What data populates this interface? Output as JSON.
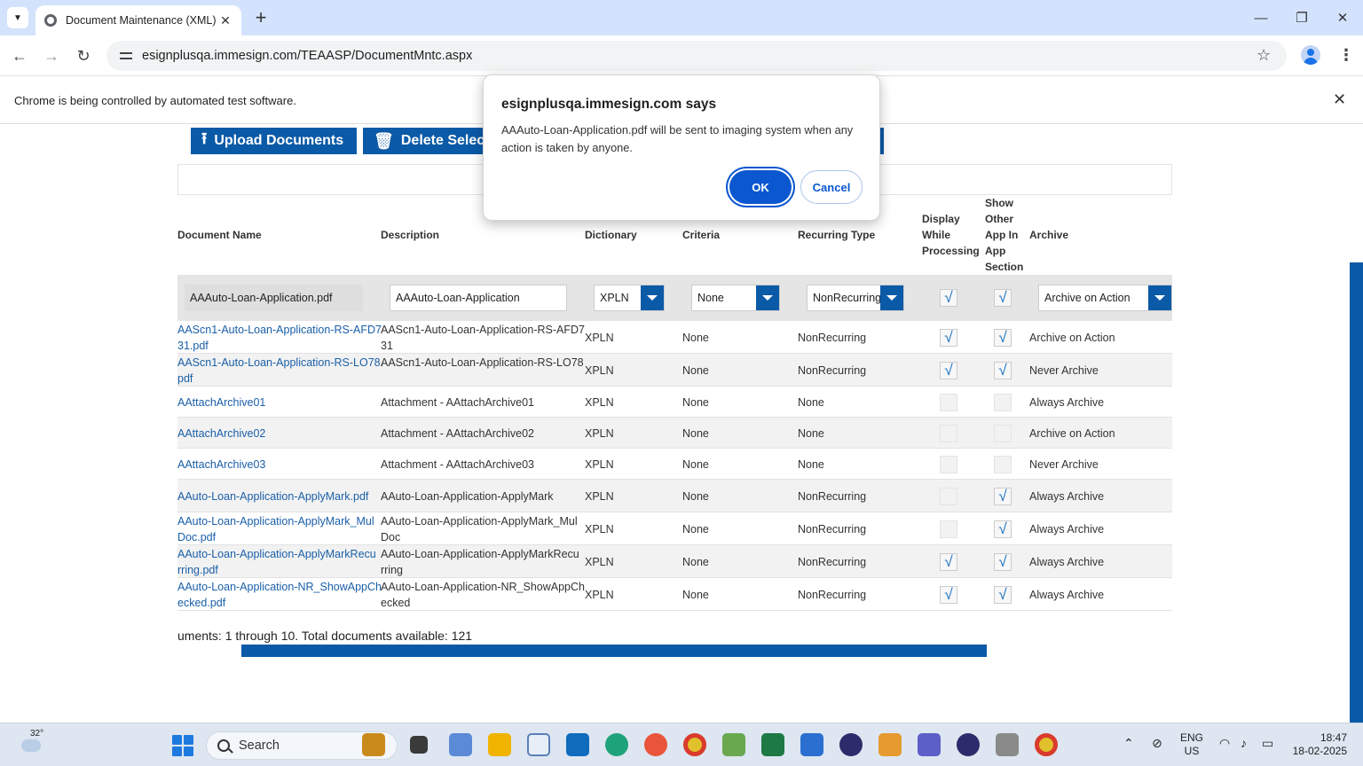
{
  "browser": {
    "tab_title": "Document Maintenance (XML)",
    "url": "esignplusqa.immesign.com/TEAASP/DocumentMntc.aspx",
    "infobar_message": "Chrome is being controlled by automated test software."
  },
  "toolbar": {
    "upload_label": "Upload Documents",
    "delete_label": "Delete Select"
  },
  "table": {
    "headers": {
      "doc_name": "Document Name",
      "description": "Description",
      "dictionary": "Dictionary",
      "criteria": "Criteria",
      "recurring": "Recurring Type",
      "display_1": "Display",
      "display_2": "While",
      "display_3": "Processing",
      "show_1": "Show",
      "show_2": "Other",
      "show_3": "App In",
      "show_4": "App",
      "show_5": "Section",
      "archive": "Archive"
    },
    "edit_row": {
      "doc_name": "AAAuto-Loan-Application.pdf",
      "description": "AAAuto-Loan-Application",
      "dictionary": "XPLN",
      "criteria": "None",
      "recurring": "NonRecurring",
      "display_checked": "√",
      "show_checked": "√",
      "archive": "Archive on Action"
    },
    "rows": [
      {
        "name_1": "AAScn1-Auto-Loan-Application-RS-AFD7",
        "name_2": "31.pdf",
        "desc_1": "AAScn1-Auto-Loan-Application-RS-AFD7",
        "desc_2": "31",
        "dict": "XPLN",
        "criteria": "None",
        "recurring": "NonRecurring",
        "display": "√",
        "show": "√",
        "archive": "Archive on Action"
      },
      {
        "name_1": "AAScn1-Auto-Loan-Application-RS-LO78.",
        "name_2": "pdf",
        "desc_1": "AAScn1-Auto-Loan-Application-RS-LO78",
        "desc_2": "",
        "dict": "XPLN",
        "criteria": "None",
        "recurring": "NonRecurring",
        "display": "√",
        "show": "√",
        "archive": "Never Archive"
      },
      {
        "name_1": "AAttachArchive01",
        "name_2": "",
        "desc_1": "Attachment - AAttachArchive01",
        "desc_2": "",
        "dict": "XPLN",
        "criteria": "None",
        "recurring": "None",
        "display": "",
        "show": "",
        "archive": "Always Archive"
      },
      {
        "name_1": "AAttachArchive02",
        "name_2": "",
        "desc_1": "Attachment - AAttachArchive02",
        "desc_2": "",
        "dict": "XPLN",
        "criteria": "None",
        "recurring": "None",
        "display": "",
        "show": "",
        "archive": "Archive on Action"
      },
      {
        "name_1": "AAttachArchive03",
        "name_2": "",
        "desc_1": "Attachment - AAttachArchive03",
        "desc_2": "",
        "dict": "XPLN",
        "criteria": "None",
        "recurring": "None",
        "display": "",
        "show": "",
        "archive": "Never Archive"
      },
      {
        "name_1": "AAuto-Loan-Application-ApplyMark.pdf",
        "name_2": "",
        "desc_1": "AAuto-Loan-Application-ApplyMark",
        "desc_2": "",
        "dict": "XPLN",
        "criteria": "None",
        "recurring": "NonRecurring",
        "display": "",
        "show": "√",
        "archive": "Always Archive"
      },
      {
        "name_1": "AAuto-Loan-Application-ApplyMark_Mul",
        "name_2": "Doc.pdf",
        "desc_1": "AAuto-Loan-Application-ApplyMark_Mul",
        "desc_2": "Doc",
        "dict": "XPLN",
        "criteria": "None",
        "recurring": "NonRecurring",
        "display": "",
        "show": "√",
        "archive": "Always Archive"
      },
      {
        "name_1": "AAuto-Loan-Application-ApplyMarkRecu",
        "name_2": "rring.pdf",
        "desc_1": "AAuto-Loan-Application-ApplyMarkRecu",
        "desc_2": "rring",
        "dict": "XPLN",
        "criteria": "None",
        "recurring": "NonRecurring",
        "display": "√",
        "show": "√",
        "archive": "Always Archive"
      },
      {
        "name_1": "AAuto-Loan-Application-NR_ShowAppCh",
        "name_2": "ecked.pdf",
        "desc_1": "AAuto-Loan-Application-NR_ShowAppCh",
        "desc_2": "ecked",
        "dict": "XPLN",
        "criteria": "None",
        "recurring": "NonRecurring",
        "display": "√",
        "show": "√",
        "archive": "Always Archive"
      }
    ],
    "footer": "uments: 1 through 10. Total documents available: 121"
  },
  "dialog": {
    "title": "esignplusqa.immesign.com says",
    "message": "AAAuto-Loan-Application.pdf will be sent to imaging system when any action is taken by anyone.",
    "ok_label": "OK",
    "cancel_label": "Cancel"
  },
  "taskbar": {
    "temperature": "32°",
    "search_placeholder": "Search",
    "lang_1": "ENG",
    "lang_2": "US",
    "time": "18:47",
    "date": "18-02-2025"
  }
}
